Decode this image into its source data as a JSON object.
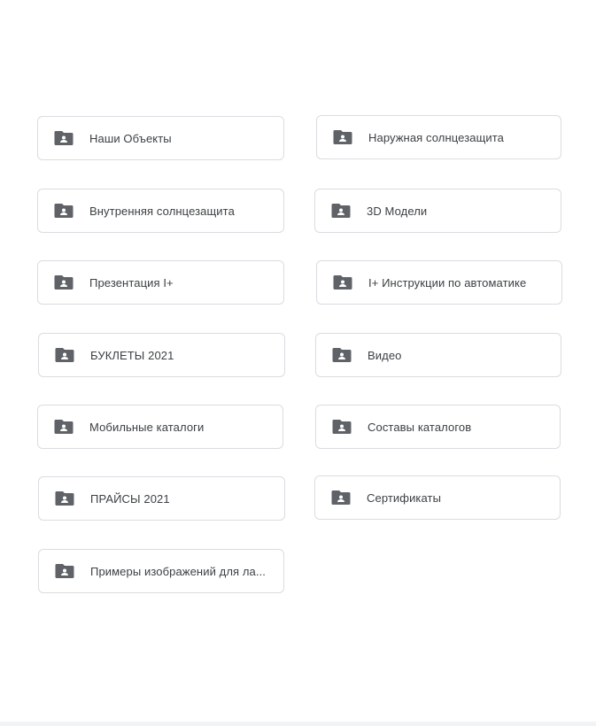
{
  "folders": [
    {
      "label": "Наши Объекты",
      "icon": "shared-folder-icon"
    },
    {
      "label": "Наружная солнцезащита",
      "icon": "shared-folder-icon"
    },
    {
      "label": "Внутренняя солнцезащита",
      "icon": "shared-folder-icon"
    },
    {
      "label": "3D Модели",
      "icon": "shared-folder-icon"
    },
    {
      "label": "Презентация I+",
      "icon": "shared-folder-icon"
    },
    {
      "label": "I+ Инструкции по автоматике",
      "icon": "shared-folder-icon"
    },
    {
      "label": "БУКЛЕТЫ 2021",
      "icon": "shared-folder-icon"
    },
    {
      "label": "Видео",
      "icon": "shared-folder-icon"
    },
    {
      "label": "Мобильные каталоги",
      "icon": "shared-folder-icon"
    },
    {
      "label": "Составы каталогов",
      "icon": "shared-folder-icon"
    },
    {
      "label": "ПРАЙСЫ 2021",
      "icon": "shared-folder-icon"
    },
    {
      "label": "Сертификаты",
      "icon": "shared-folder-icon"
    },
    {
      "label": "Примеры изображений для ла...",
      "icon": "shared-folder-icon"
    }
  ],
  "colors": {
    "card_border": "#dadce0",
    "icon": "#5f6368",
    "text": "#3c4043",
    "background": "#ffffff"
  }
}
